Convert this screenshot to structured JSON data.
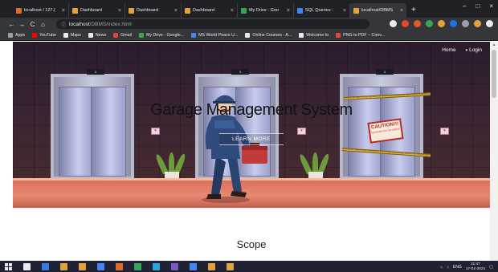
{
  "browser": {
    "tabs": [
      {
        "label": "localhost / 127.(",
        "color": "#e06c2c",
        "active": false
      },
      {
        "label": "Dashboard",
        "color": "#e6a23a",
        "active": false
      },
      {
        "label": "Dashboard",
        "color": "#e6a23a",
        "active": false
      },
      {
        "label": "Dashboard",
        "color": "#e6a23a",
        "active": false
      },
      {
        "label": "My Drive - Goo",
        "color": "#35a853",
        "active": false
      },
      {
        "label": "SQL Queries - ",
        "color": "#4285f4",
        "active": false
      },
      {
        "label": "localhost/DBMS",
        "color": "#e6a23a",
        "active": true
      }
    ],
    "new_tab": "+",
    "window_controls": {
      "minimize": "–",
      "maximize": "□",
      "close": "×"
    },
    "nav": {
      "back": "←",
      "forward": "→",
      "reload": "C",
      "home": "⌂"
    },
    "address": {
      "info_icon": "ⓘ",
      "host": "localhost",
      "path": "/DBMS/index.html"
    },
    "bookmarks": [
      {
        "label": "Apps",
        "color": "#9aa0a6"
      },
      {
        "label": "YouTube",
        "color": "#ff0000"
      },
      {
        "label": "Maps",
        "color": "#e8eaed"
      },
      {
        "label": "News",
        "color": "#e8eaed"
      },
      {
        "label": "Gmail",
        "color": "#ea4335"
      },
      {
        "label": "My Drive - Google...",
        "color": "#35a853"
      },
      {
        "label": "MS World Peace U...",
        "color": "#4285f4"
      },
      {
        "label": "Online Courses - A...",
        "color": "#e8eaed"
      },
      {
        "label": "Welcome to",
        "color": "#e8eaed"
      },
      {
        "label": "PNG to PDF – Conv...",
        "color": "#ea4335"
      }
    ],
    "extension_colors": [
      "#e8eaed",
      "#ea4335",
      "#e05a2b",
      "#35a853",
      "#e6a23a",
      "#1a73e8",
      "#9aa0a6",
      "#e6a23a",
      "#e8eaed"
    ]
  },
  "page": {
    "nav": {
      "home": "Home",
      "login": "Login",
      "login_caret": "▾"
    },
    "hero": {
      "title": "Garage Management System",
      "button": "LEARN MORE",
      "elevator_floors": [
        "1",
        "1",
        "1"
      ],
      "call_arrow": "▾",
      "caution_heading": "CAUTION!!!",
      "caution_text": "ELEVATOR OUT OF ORDER",
      "tape_text": "WARNING WARNING WARNING WARNING WARNING WARNING WARNING"
    },
    "section_heading": "Scope"
  },
  "taskbar": {
    "icon_colors": [
      "#e8eaed",
      "#3b78e7",
      "#e6a23a",
      "#e6a23a",
      "#4285f4",
      "#e06c2c",
      "#35a853",
      "#2fa3e0",
      "#7e57c2",
      "#4285f4",
      "#e6a23a",
      "#e6a23a"
    ],
    "lang": "ENG",
    "time": "11:47",
    "date": "17-02-2021"
  },
  "colors": {
    "hero_wall": "#3e2733",
    "floor": "#e58a72",
    "title": "#131313"
  }
}
